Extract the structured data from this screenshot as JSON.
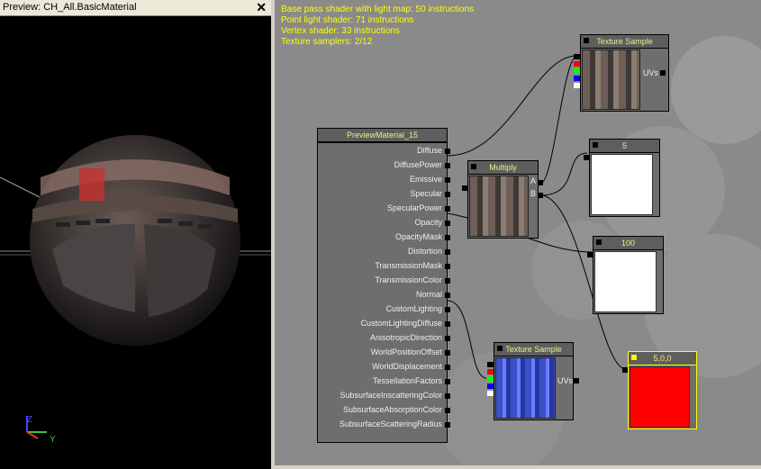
{
  "preview": {
    "title": "Preview: CH_All.BasicMaterial",
    "close": "✕",
    "axis_z": "Z",
    "axis_y": "Y"
  },
  "stats": {
    "lines": [
      "Base pass shader with light map: 50 instructions",
      "Point light shader: 71 instructions",
      "Vertex shader: 33 instructions",
      "Texture samplers: 2/12"
    ]
  },
  "material": {
    "title": "PreviewMaterial_15",
    "inputs": [
      "Diffuse",
      "DiffusePower",
      "Emissive",
      "Specular",
      "SpecularPower",
      "Opacity",
      "OpacityMask",
      "Distortion",
      "TransmissionMask",
      "TransmissionColor",
      "Normal",
      "CustomLighting",
      "CustomLightingDiffuse",
      "AnisotropicDirection",
      "WorldPositionOffset",
      "WorldDisplacement",
      "TessellationFactors",
      "SubsurfaceInscatteringColor",
      "SubsurfaceAbsorptionColor",
      "SubsurfaceScatteringRadius"
    ]
  },
  "nodes": {
    "tex1": {
      "title": "Texture Sample",
      "uvs": "UVs"
    },
    "multiply": {
      "title": "Multiply",
      "a": "A",
      "b": "B"
    },
    "const5": {
      "title": "5"
    },
    "const100": {
      "title": "100"
    },
    "tex2": {
      "title": "Texture Sample",
      "uvs": "UVs"
    },
    "vec": {
      "title": "5,0,0",
      "color": "#ff0000"
    }
  },
  "colors": {
    "accent": "#f0ec82",
    "stats": "#ffff00",
    "selected": "#ffff00"
  }
}
